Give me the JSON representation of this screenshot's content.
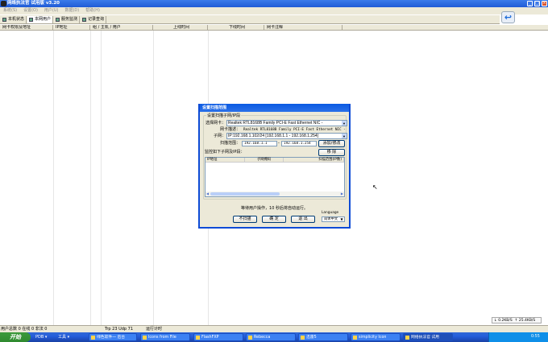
{
  "window": {
    "title": "网络执法官  试用版  v3.20",
    "min": "_",
    "max": "□",
    "close": "×"
  },
  "menu": [
    "系统(S)",
    "设置(O)",
    "用户(U)",
    "数据(D)",
    "帮助(H)"
  ],
  "tabs": [
    {
      "label": "本机状态"
    },
    {
      "label": "本网用户",
      "active": true
    },
    {
      "label": "服务监测"
    },
    {
      "label": "记录查询"
    }
  ],
  "list_columns": [
    "网卡权限及地址",
    "IP地址",
    "组 / 主机 / 用户",
    "上线时间",
    "下线时间",
    "网卡注释"
  ],
  "status": {
    "users": "用户总数 0 在线 0 非法 0",
    "traffic": "Trp 23 Udp 71",
    "timer": "运行计时"
  },
  "speed": {
    "up": "0.2KB/S",
    "down": "25.4KB/S"
  },
  "dialog": {
    "title": "设置扫描范围",
    "group_label": "设置扫描子网/IP段",
    "nic_label": "选择网卡：",
    "nic_value": "Realtek RTL8168B Family PCI-E Fast Ethernet NIC -",
    "desc_label": "网卡描述：",
    "desc_value": "Realtek RTL8168B Family PCI-E Fast Ethernet NIC - 数",
    "subnet_label": "子网：",
    "subnet_value": "IP:192.168.1.102/24 [192.168.1.1 - 192.168.1.254]",
    "range_label": "扫描范围：",
    "range_from": "192.168.1.1",
    "range_sep": "-",
    "range_to": "192.168.1.254",
    "add_button": "添加/修改",
    "remove_button": "移 除",
    "monitor_label": "监控如下子网及IP段：",
    "table_columns": [
      "IP地址",
      "子网掩码",
      "扫描范围(IP数)"
    ],
    "countdown": "等待用户操作，10 秒后将自动运行。",
    "noscan_button": "不扫描",
    "ok_button": "确 定",
    "exit_button": "退 出",
    "language_label": "Language",
    "language_value": "简体中文"
  },
  "taskbar": {
    "start": "开始",
    "quick": [
      "PDB ▾",
      "工具 ▾"
    ],
    "tasks": [
      "绿色软件一 后台",
      "Icons from File",
      "FlashFXP",
      "Rebecca",
      "迅雷5",
      "simplicity Icon",
      "网络执法官 试用"
    ],
    "clock": "0:55"
  }
}
